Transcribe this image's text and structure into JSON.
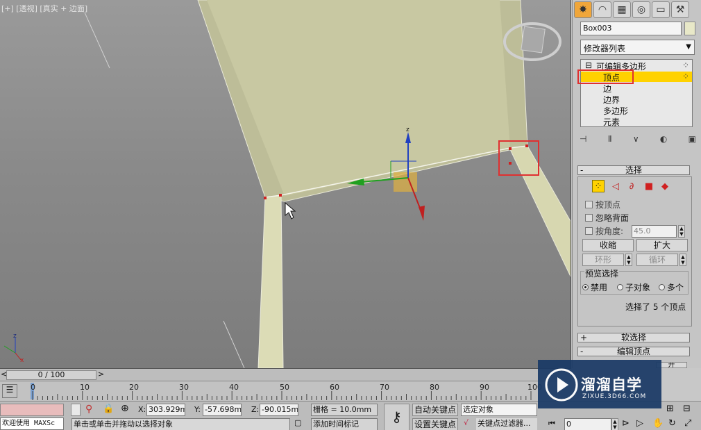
{
  "viewport": {
    "label": "[+] [透视] [真实 + 边面]"
  },
  "command_panel": {
    "tabs": [
      "create-icon",
      "modify-icon",
      "hierarchy-icon",
      "motion-icon",
      "display-icon",
      "utilities-icon"
    ],
    "object_name": "Box003",
    "modifier_list": "修改器列表",
    "stack": {
      "root": "可编辑多边形",
      "items": [
        "顶点",
        "边",
        "边界",
        "多边形",
        "元素"
      ],
      "selected_index": 0
    },
    "selection": {
      "title": "选择",
      "by_vertex": "按顶点",
      "ignore_backfacing": "忽略背面",
      "by_angle": "按角度:",
      "angle_value": "45.0",
      "shrink": "收缩",
      "grow": "扩大",
      "ring": "环形",
      "loop": "循环",
      "preview_title": "预览选择",
      "preview_options": [
        "禁用",
        "子对象",
        "多个"
      ],
      "preview_selected": 0,
      "status": "选择了 5 个顶点"
    },
    "soft_selection": "软选择",
    "edit_vertices": "编辑顶点",
    "partial_button": "开"
  },
  "timeline": {
    "frame": "0 / 100",
    "ticks": [
      "0",
      "10",
      "20",
      "30",
      "40",
      "50",
      "60",
      "70",
      "80",
      "90",
      "100"
    ]
  },
  "status_bar": {
    "welcome": "欢迎使用 MAXSc",
    "prompt": "单击或单击并拖动以选择对象",
    "x_label": "X:",
    "x_value": "303.929mr",
    "y_label": "Y:",
    "y_value": "-57.698mr",
    "z_label": "Z:",
    "z_value": "-90.015mr",
    "grid": "栅格 = 10.0mm",
    "auto_key": "自动关键点",
    "set_key": "设置关键点",
    "selected_object": "选定对象",
    "add_time_tag": "添加时间标记",
    "key_filters": "关键点过滤器...",
    "frame_field": "0"
  },
  "watermark": {
    "title": "溜溜自学",
    "url": "ZIXUE.3D66.COM"
  },
  "colors": {
    "accent_yellow": "#ffd200",
    "highlight_red": "#e03030",
    "bar_color": "#d7d7b0"
  }
}
